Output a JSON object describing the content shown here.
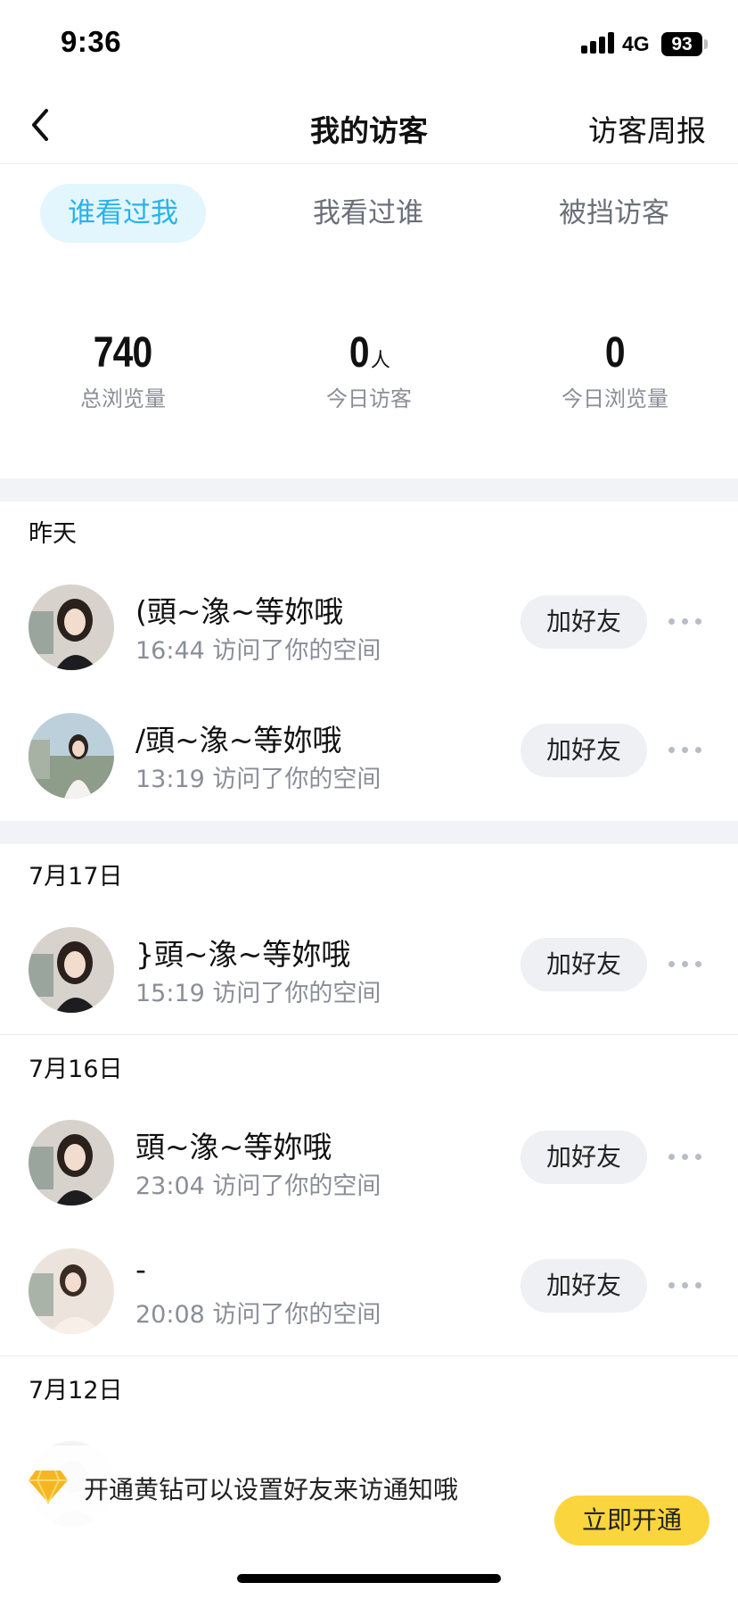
{
  "status_bar": {
    "time": "9:36",
    "network": "4G",
    "battery": "93"
  },
  "nav": {
    "back_icon": "chevron-left-icon",
    "title": "我的访客",
    "right_label": "访客周报"
  },
  "tabs": [
    {
      "label": "谁看过我",
      "active": true
    },
    {
      "label": "我看过谁",
      "active": false
    },
    {
      "label": "被挡访客",
      "active": false
    }
  ],
  "stats": [
    {
      "value": "740",
      "unit": "",
      "label": "总浏览量"
    },
    {
      "value": "0",
      "unit": "人",
      "label": "今日访客"
    },
    {
      "value": "0",
      "unit": "",
      "label": "今日浏览量"
    }
  ],
  "groups": [
    {
      "date": "昨天",
      "visitors": [
        {
          "name": "(頭~潒~等妳哦",
          "meta": "16:44 访问了你的空间",
          "button": "加好友"
        },
        {
          "name": "/頭~潒~等妳哦",
          "meta": "13:19 访问了你的空间",
          "button": "加好友"
        }
      ]
    },
    {
      "date": "7月17日",
      "visitors": [
        {
          "name": "}頭~潒~等妳哦",
          "meta": "15:19 访问了你的空间",
          "button": "加好友"
        }
      ]
    },
    {
      "date": "7月16日",
      "visitors": [
        {
          "name": "頭~潒~等妳哦",
          "meta": "23:04 访问了你的空间",
          "button": "加好友"
        },
        {
          "name": "-",
          "meta": "20:08 访问了你的空间",
          "button": "加好友"
        }
      ]
    },
    {
      "date": "7月12日",
      "visitors": []
    }
  ],
  "banner": {
    "icon": "diamond-icon",
    "text": "开通黄钻可以设置好友来访通知哦",
    "button": "立即开通"
  },
  "colors": {
    "accent": "#27b3ec",
    "tab_active_bg": "#e3f6fd",
    "cta_yellow": "#fbd53d",
    "muted": "#8a8e97"
  }
}
